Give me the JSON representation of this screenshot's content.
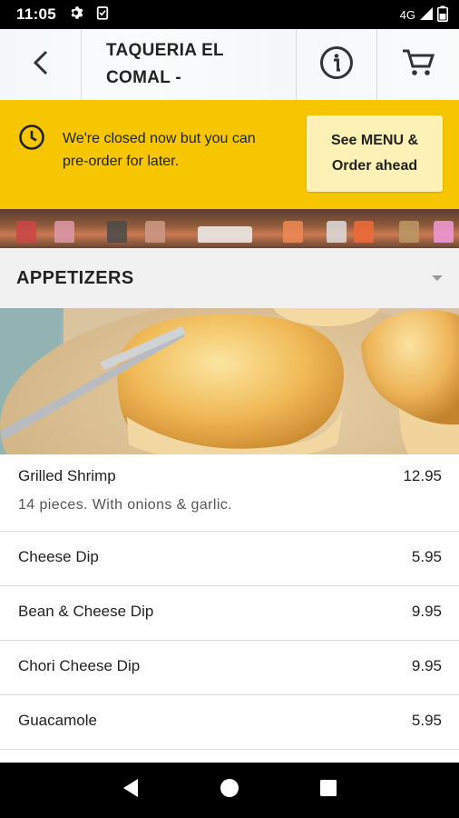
{
  "status_bar": {
    "time": "11:05",
    "network": "4G",
    "icons": [
      "gear-icon",
      "clipboard-icon",
      "signal-icon",
      "battery-icon"
    ]
  },
  "header": {
    "title_line1": "TAQUERIA EL",
    "title_line2": "COMAL -",
    "back_icon": "chevron-left-icon",
    "info_icon": "info-icon",
    "cart_icon": "cart-icon"
  },
  "closed_banner": {
    "message_line1": "We're closed now but you can",
    "message_line2": "pre-order for later.",
    "button_line1": "See MENU &",
    "button_line2": "Order ahead",
    "color": "#f6c600"
  },
  "category": {
    "title": "APPETIZERS"
  },
  "menu_items": [
    {
      "name": "Grilled Shrimp",
      "price": "12.95",
      "description": "14 pieces. With onions & garlic."
    },
    {
      "name": "Cheese Dip",
      "price": "5.95"
    },
    {
      "name": "Bean & Cheese Dip",
      "price": "9.95"
    },
    {
      "name": "Chori Cheese Dip",
      "price": "9.95"
    },
    {
      "name": "Guacamole",
      "price": "5.95"
    }
  ]
}
